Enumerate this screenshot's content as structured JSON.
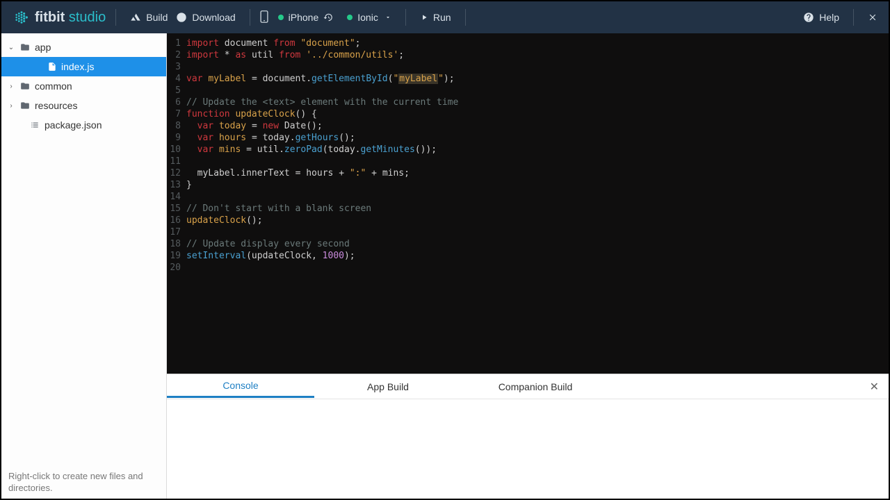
{
  "brand": {
    "bold": "fitbit",
    "light": "studio"
  },
  "toolbar": {
    "build_label": "Build",
    "download_label": "Download",
    "phone_label": "iPhone",
    "watch_label": "Ionic",
    "run_label": "Run",
    "help_label": "Help"
  },
  "sidebar": {
    "items": [
      {
        "label": "app",
        "kind": "folder",
        "expanded": true,
        "depth": 0
      },
      {
        "label": "index.js",
        "kind": "file-js",
        "depth": 1,
        "selected": true
      },
      {
        "label": "common",
        "kind": "folder",
        "expanded": false,
        "depth": 0
      },
      {
        "label": "resources",
        "kind": "folder",
        "expanded": false,
        "depth": 0
      },
      {
        "label": "package.json",
        "kind": "file-json",
        "depth": 0
      }
    ],
    "hint": "Right-click to create new files and directories."
  },
  "editor": {
    "lines": [
      [
        {
          "t": "import ",
          "c": "tok-import"
        },
        {
          "t": "document ",
          "c": "tok-module"
        },
        {
          "t": "from ",
          "c": "tok-import"
        },
        {
          "t": "\"document\"",
          "c": "tok-str"
        },
        {
          "t": ";",
          "c": "tok-op"
        }
      ],
      [
        {
          "t": "import ",
          "c": "tok-import"
        },
        {
          "t": "* ",
          "c": "tok-op"
        },
        {
          "t": "as ",
          "c": "tok-import"
        },
        {
          "t": "util ",
          "c": "tok-module"
        },
        {
          "t": "from ",
          "c": "tok-import"
        },
        {
          "t": "'../common/utils'",
          "c": "tok-str"
        },
        {
          "t": ";",
          "c": "tok-op"
        }
      ],
      [],
      [
        {
          "t": "var ",
          "c": "tok-kw"
        },
        {
          "t": "myLabel ",
          "c": "tok-ident"
        },
        {
          "t": "= ",
          "c": "tok-op"
        },
        {
          "t": "document",
          "c": "tok-var"
        },
        {
          "t": ".",
          "c": "tok-op"
        },
        {
          "t": "getElementById",
          "c": "tok-fn"
        },
        {
          "t": "(",
          "c": "tok-op"
        },
        {
          "t": "\"",
          "c": "tok-str"
        },
        {
          "t": "myLabel",
          "c": "tok-str tok-hl"
        },
        {
          "t": "\"",
          "c": "tok-str"
        },
        {
          "t": ");",
          "c": "tok-op"
        }
      ],
      [],
      [
        {
          "t": "// Update the <text> element with the current time",
          "c": "tok-com"
        }
      ],
      [
        {
          "t": "function ",
          "c": "tok-kw"
        },
        {
          "t": "updateClock",
          "c": "tok-ident"
        },
        {
          "t": "() {",
          "c": "tok-op"
        }
      ],
      [
        {
          "t": "  var ",
          "c": "tok-kw"
        },
        {
          "t": "today ",
          "c": "tok-ident"
        },
        {
          "t": "= ",
          "c": "tok-op"
        },
        {
          "t": "new ",
          "c": "tok-kw"
        },
        {
          "t": "Date",
          "c": "tok-var"
        },
        {
          "t": "();",
          "c": "tok-op"
        }
      ],
      [
        {
          "t": "  var ",
          "c": "tok-kw"
        },
        {
          "t": "hours ",
          "c": "tok-ident"
        },
        {
          "t": "= ",
          "c": "tok-op"
        },
        {
          "t": "today",
          "c": "tok-var"
        },
        {
          "t": ".",
          "c": "tok-op"
        },
        {
          "t": "getHours",
          "c": "tok-fn"
        },
        {
          "t": "();",
          "c": "tok-op"
        }
      ],
      [
        {
          "t": "  var ",
          "c": "tok-kw"
        },
        {
          "t": "mins ",
          "c": "tok-ident"
        },
        {
          "t": "= ",
          "c": "tok-op"
        },
        {
          "t": "util",
          "c": "tok-var"
        },
        {
          "t": ".",
          "c": "tok-op"
        },
        {
          "t": "zeroPad",
          "c": "tok-fn"
        },
        {
          "t": "(",
          "c": "tok-op"
        },
        {
          "t": "today",
          "c": "tok-var"
        },
        {
          "t": ".",
          "c": "tok-op"
        },
        {
          "t": "getMinutes",
          "c": "tok-fn"
        },
        {
          "t": "());",
          "c": "tok-op"
        }
      ],
      [],
      [
        {
          "t": "  myLabel",
          "c": "tok-var"
        },
        {
          "t": ".",
          "c": "tok-op"
        },
        {
          "t": "innerText ",
          "c": "tok-var"
        },
        {
          "t": "= ",
          "c": "tok-op"
        },
        {
          "t": "hours ",
          "c": "tok-var"
        },
        {
          "t": "+ ",
          "c": "tok-op"
        },
        {
          "t": "\":\"",
          "c": "tok-str"
        },
        {
          "t": " + ",
          "c": "tok-op"
        },
        {
          "t": "mins",
          "c": "tok-var"
        },
        {
          "t": ";",
          "c": "tok-op"
        }
      ],
      [
        {
          "t": "}",
          "c": "tok-op"
        }
      ],
      [],
      [
        {
          "t": "// Don't start with a blank screen",
          "c": "tok-com"
        }
      ],
      [
        {
          "t": "updateClock",
          "c": "tok-ident"
        },
        {
          "t": "();",
          "c": "tok-op"
        }
      ],
      [],
      [
        {
          "t": "// Update display every second",
          "c": "tok-com"
        }
      ],
      [
        {
          "t": "setInterval",
          "c": "tok-fn"
        },
        {
          "t": "(",
          "c": "tok-op"
        },
        {
          "t": "updateClock",
          "c": "tok-var"
        },
        {
          "t": ", ",
          "c": "tok-op"
        },
        {
          "t": "1000",
          "c": "tok-num"
        },
        {
          "t": ");",
          "c": "tok-op"
        }
      ],
      []
    ]
  },
  "panel": {
    "tabs": [
      {
        "label": "Console",
        "active": true
      },
      {
        "label": "App Build",
        "active": false
      },
      {
        "label": "Companion Build",
        "active": false
      }
    ]
  }
}
